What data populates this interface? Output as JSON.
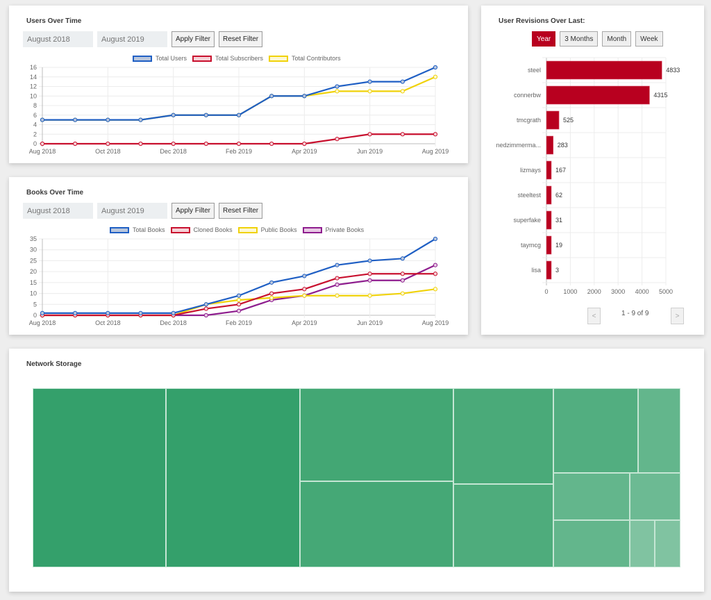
{
  "users_card": {
    "title": "Users Over Time",
    "date_from": "August 2018",
    "date_to": "August 2019",
    "apply_label": "Apply Filter",
    "reset_label": "Reset Filter"
  },
  "books_card": {
    "title": "Books Over Time",
    "date_from": "August 2018",
    "date_to": "August 2019",
    "apply_label": "Apply Filter",
    "reset_label": "Reset Filter"
  },
  "revisions_card": {
    "title": "User Revisions Over Last:",
    "ranges": [
      {
        "label": "Year",
        "active": true
      },
      {
        "label": "3 Months",
        "active": false
      },
      {
        "label": "Month",
        "active": false
      },
      {
        "label": "Week",
        "active": false
      }
    ],
    "pager_prev": "<",
    "pager_next": ">",
    "pager_text": "1 - 9 of 9"
  },
  "network_card": {
    "title": "Network Storage"
  },
  "chart_data": [
    {
      "type": "line",
      "title": "Users Over Time",
      "x": [
        "Aug 2018",
        "Sep 2018",
        "Oct 2018",
        "Nov 2018",
        "Dec 2018",
        "Jan 2019",
        "Feb 2019",
        "Mar 2019",
        "Apr 2019",
        "May 2019",
        "Jun 2019",
        "Jul 2019",
        "Aug 2019"
      ],
      "xticks": [
        "Aug 2018",
        "Oct 2018",
        "Dec 2018",
        "Feb 2019",
        "Apr 2019",
        "Jun 2019",
        "Aug 2019"
      ],
      "yticks": [
        0,
        2,
        4,
        6,
        8,
        10,
        12,
        14,
        16
      ],
      "ylim": [
        0,
        16
      ],
      "grid": true,
      "legend": "top",
      "series": [
        {
          "name": "Total Users",
          "color": "#1f5fc4",
          "fill": "#b9c6dc",
          "values": [
            5,
            5,
            5,
            5,
            6,
            6,
            6,
            10,
            10,
            12,
            13,
            13,
            16
          ]
        },
        {
          "name": "Total Subscribers",
          "color": "#c8102e",
          "fill": "#f5d0d6",
          "values": [
            0,
            0,
            0,
            0,
            0,
            0,
            0,
            0,
            0,
            1,
            2,
            2,
            2
          ]
        },
        {
          "name": "Total Contributors",
          "color": "#f0d20a",
          "fill": "#fdf8d2",
          "values": [
            5,
            5,
            5,
            5,
            6,
            6,
            6,
            10,
            10,
            11,
            11,
            11,
            14
          ]
        }
      ]
    },
    {
      "type": "line",
      "title": "Books Over Time",
      "x": [
        "Aug 2018",
        "Sep 2018",
        "Oct 2018",
        "Nov 2018",
        "Dec 2018",
        "Jan 2019",
        "Feb 2019",
        "Mar 2019",
        "Apr 2019",
        "May 2019",
        "Jun 2019",
        "Jul 2019",
        "Aug 2019"
      ],
      "xticks": [
        "Aug 2018",
        "Oct 2018",
        "Dec 2018",
        "Feb 2019",
        "Apr 2019",
        "Jun 2019",
        "Aug 2019"
      ],
      "yticks": [
        0,
        5,
        10,
        15,
        20,
        25,
        30,
        35
      ],
      "ylim": [
        0,
        35
      ],
      "grid": true,
      "legend": "top",
      "series": [
        {
          "name": "Total Books",
          "color": "#1f5fc4",
          "fill": "#b9c6dc",
          "values": [
            1,
            1,
            1,
            1,
            1,
            5,
            9,
            15,
            18,
            23,
            25,
            26,
            35
          ]
        },
        {
          "name": "Cloned Books",
          "color": "#c8102e",
          "fill": "#f5d0d6",
          "values": [
            0,
            0,
            0,
            0,
            0,
            3,
            5,
            10,
            12,
            17,
            19,
            19,
            19
          ]
        },
        {
          "name": "Public Books",
          "color": "#f0d20a",
          "fill": "#fdf8d2",
          "values": [
            0,
            0,
            0,
            0,
            0,
            5,
            7,
            8,
            9,
            9,
            9,
            10,
            12
          ]
        },
        {
          "name": "Private Books",
          "color": "#8e1d8e",
          "fill": "#e8c8e4",
          "values": [
            0,
            0,
            0,
            0,
            0,
            0,
            2,
            7,
            9,
            14,
            16,
            16,
            23
          ]
        }
      ]
    },
    {
      "type": "bar",
      "orientation": "horizontal",
      "title": "User Revisions Over Last: Year",
      "categories": [
        "steel",
        "connerbw",
        "tmcgrath",
        "nedzimmerma...",
        "lizmays",
        "steeltest",
        "superfake",
        "taymcg",
        "lisa"
      ],
      "values": [
        4833,
        4315,
        525,
        283,
        167,
        62,
        31,
        19,
        3
      ],
      "xticks": [
        0,
        1000,
        2000,
        3000,
        4000,
        5000
      ],
      "xlim": [
        0,
        5000
      ],
      "color": "#b8001f",
      "grid": true
    },
    {
      "type": "heatmap",
      "subtype": "treemap",
      "title": "Network Storage",
      "cells": [
        {
          "rel": [
            0.0,
            0.0,
            0.2058,
            1.0
          ],
          "color": "#34a06b"
        },
        {
          "rel": [
            0.2058,
            0.0,
            0.2069,
            1.0
          ],
          "color": "#34a06b"
        },
        {
          "rel": [
            0.4127,
            0.0,
            0.2369,
            0.5194
          ],
          "color": "#43a774"
        },
        {
          "rel": [
            0.4127,
            0.5194,
            0.2369,
            0.4806
          ],
          "color": "#45a876"
        },
        {
          "rel": [
            0.6496,
            0.0,
            0.1543,
            0.5349
          ],
          "color": "#4aaa79"
        },
        {
          "rel": [
            0.6496,
            0.5349,
            0.1543,
            0.4651
          ],
          "color": "#4eac7c"
        },
        {
          "rel": [
            0.8039,
            0.0,
            0.1308,
            0.4729
          ],
          "color": "#52ae80"
        },
        {
          "rel": [
            0.9347,
            0.0,
            0.0653,
            0.4729
          ],
          "color": "#63b68c"
        },
        {
          "rel": [
            0.8039,
            0.4729,
            0.1179,
            0.2636
          ],
          "color": "#63b68c"
        },
        {
          "rel": [
            0.9218,
            0.4729,
            0.0782,
            0.2636
          ],
          "color": "#6cba93"
        },
        {
          "rel": [
            0.8039,
            0.7364,
            0.1179,
            0.2636
          ],
          "color": "#63b68c"
        },
        {
          "rel": [
            0.9218,
            0.7364,
            0.0386,
            0.2636
          ],
          "color": "#80c3a1"
        },
        {
          "rel": [
            0.9603,
            0.7364,
            0.0397,
            0.2636
          ],
          "color": "#80c3a1"
        }
      ]
    }
  ]
}
